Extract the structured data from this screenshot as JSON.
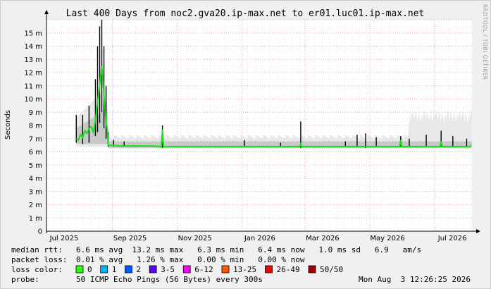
{
  "title": "Last 400 Days from noc2.gva20.ip-max.net to er01.luc01.ip-max.net",
  "watermark": "RRDTOOL / TOBI OETIKER",
  "chart_data": {
    "type": "line",
    "ylabel": "Seconds",
    "ylim": [
      0,
      0.016
    ],
    "yticks": [
      "0",
      "1 m",
      "2 m",
      "3 m",
      "4 m",
      "5 m",
      "6 m",
      "7 m",
      "8 m",
      "9 m",
      "10 m",
      "11 m",
      "12 m",
      "13 m",
      "14 m",
      "15 m"
    ],
    "xticks": [
      "Jul 2025",
      "Sep 2025",
      "Nov 2025",
      "Jan 2026",
      "Mar 2026",
      "May 2026",
      "Jul 2026"
    ],
    "x_range_days": 400,
    "data_start_day": 28,
    "x_tick_days": [
      0,
      62,
      123,
      184,
      243,
      304,
      365
    ],
    "median_ms": [
      [
        28,
        7.0
      ],
      [
        30,
        6.9
      ],
      [
        32,
        7.3
      ],
      [
        34,
        7.1
      ],
      [
        36,
        7.6
      ],
      [
        38,
        7.4
      ],
      [
        40,
        7.8
      ],
      [
        42,
        7.9
      ],
      [
        44,
        7.5
      ],
      [
        46,
        8.4
      ],
      [
        48,
        9.8
      ],
      [
        50,
        11.0
      ],
      [
        52,
        12.5
      ],
      [
        54,
        10.4
      ],
      [
        56,
        8.1
      ],
      [
        57,
        7.8
      ],
      [
        58,
        6.5
      ],
      [
        70,
        6.45
      ],
      [
        100,
        6.45
      ],
      [
        108,
        6.4
      ],
      [
        109,
        7.7
      ],
      [
        110,
        6.4
      ],
      [
        150,
        6.4
      ],
      [
        200,
        6.4
      ],
      [
        238,
        6.4
      ],
      [
        239,
        6.6
      ],
      [
        240,
        6.4
      ],
      [
        300,
        6.4
      ],
      [
        332,
        6.4
      ],
      [
        333,
        6.9
      ],
      [
        334,
        6.4
      ],
      [
        370,
        6.4
      ],
      [
        371,
        6.8
      ],
      [
        372,
        6.4
      ],
      [
        398,
        6.4
      ],
      [
        399,
        6.5
      ]
    ],
    "rtt_spikes_ms": [
      [
        28,
        6.7,
        8.8
      ],
      [
        34,
        6.6,
        8.8
      ],
      [
        40,
        6.7,
        9.5
      ],
      [
        46,
        7.2,
        11.5
      ],
      [
        48,
        7.5,
        14.0
      ],
      [
        50,
        8.2,
        15.5
      ],
      [
        52,
        9.0,
        16.0
      ],
      [
        54,
        7.8,
        14.0
      ],
      [
        56,
        7.0,
        11.0
      ],
      [
        58,
        6.4,
        7.5
      ],
      [
        63,
        6.4,
        6.9
      ],
      [
        73,
        6.4,
        6.8
      ],
      [
        109,
        6.3,
        8.0
      ],
      [
        186,
        6.4,
        6.9
      ],
      [
        220,
        6.4,
        6.7
      ],
      [
        239,
        6.3,
        8.3
      ],
      [
        281,
        6.4,
        6.8
      ],
      [
        292,
        6.4,
        7.3
      ],
      [
        300,
        6.3,
        7.4
      ],
      [
        310,
        6.4,
        7.1
      ],
      [
        333,
        6.4,
        7.2
      ],
      [
        341,
        6.4,
        7.0
      ],
      [
        357,
        6.4,
        7.3
      ],
      [
        371,
        6.4,
        7.6
      ],
      [
        382,
        6.4,
        7.2
      ],
      [
        395,
        6.4,
        7.0
      ]
    ],
    "legend": [
      "0",
      "1",
      "2",
      "3-5",
      "6-12",
      "13-25",
      "26-49",
      "50/50"
    ]
  },
  "stats": {
    "rtt_label": "median rtt:",
    "rtt_values": "6.6 ms avg  13.2 ms max   6.3 ms min   6.4 ms now   1.0 ms sd   6.9   am/s",
    "loss_label": "packet loss:",
    "loss_values": "0.01 % avg   1.26 % max   0.00 % min   0.00 % now",
    "color_label": "loss color:",
    "probe_label": "probe:",
    "probe_values": "50 ICMP Echo Pings (56 Bytes) every 300s",
    "timestamp": "Mon Aug  3 12:26:25 2026"
  },
  "colors": {
    "median": "#16e016",
    "spike": "#000000",
    "band_light": "#e8e8e8",
    "band_mid": "#c8c8c8",
    "grid_minor": "#e5e5e5",
    "grid_major": "#f0a8a8",
    "background": "#f0f0f0",
    "legend": [
      "#26ff00",
      "#00b8ff",
      "#0059ff",
      "#5e00ff",
      "#ff00ff",
      "#ff5500",
      "#ff0000",
      "#a10000"
    ]
  }
}
